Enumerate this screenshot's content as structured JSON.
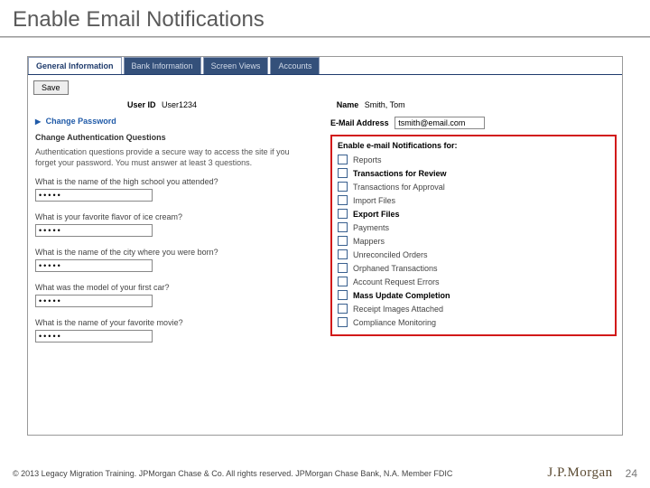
{
  "slide": {
    "title": "Enable Email Notifications"
  },
  "tabs": [
    "General Information",
    "Bank Information",
    "Screen Views",
    "Accounts"
  ],
  "toolbar": {
    "save": "Save"
  },
  "user": {
    "id_label": "User ID",
    "id_value": "User1234",
    "name_label": "Name",
    "name_value": "Smith, Tom"
  },
  "left": {
    "change_password": "Change Password",
    "auth_title": "Change Authentication Questions",
    "auth_desc": "Authentication questions provide a secure way to access the site if you forget your password. You must answer at least 3 questions.",
    "questions": [
      {
        "q": "What is the name of the high school you attended?",
        "a": "•••••"
      },
      {
        "q": "What is your favorite flavor of ice cream?",
        "a": "•••••"
      },
      {
        "q": "What is the name of the city where you were born?",
        "a": "•••••"
      },
      {
        "q": "What was the model of your first car?",
        "a": "•••••"
      },
      {
        "q": "What is the name of your favorite movie?",
        "a": "•••••"
      }
    ]
  },
  "right": {
    "email_label": "E-Mail Address",
    "email_value": "tsmith@email.com",
    "notif_title": "Enable e-mail Notifications for:",
    "notif": [
      {
        "label": "Reports",
        "checked": false
      },
      {
        "label": "Transactions for Review",
        "checked": false,
        "bold": true
      },
      {
        "label": "Transactions for Approval",
        "checked": false
      },
      {
        "label": "Import Files",
        "checked": false
      },
      {
        "label": "Export Files",
        "checked": false,
        "bold": true
      },
      {
        "label": "Payments",
        "checked": false
      },
      {
        "label": "Mappers",
        "checked": false
      },
      {
        "label": "Unreconciled Orders",
        "checked": false
      },
      {
        "label": "Orphaned Transactions",
        "checked": false
      },
      {
        "label": "Account Request Errors",
        "checked": false
      },
      {
        "label": "Mass Update Completion",
        "checked": false,
        "bold": true
      },
      {
        "label": "Receipt Images Attached",
        "checked": false
      },
      {
        "label": "Compliance Monitoring",
        "checked": false
      }
    ]
  },
  "footer": {
    "copyright": "© 2013 Legacy Migration Training. JPMorgan Chase & Co. All rights reserved. JPMorgan Chase Bank, N.A. Member FDIC",
    "logo": "J.P.Morgan",
    "page": "24"
  }
}
